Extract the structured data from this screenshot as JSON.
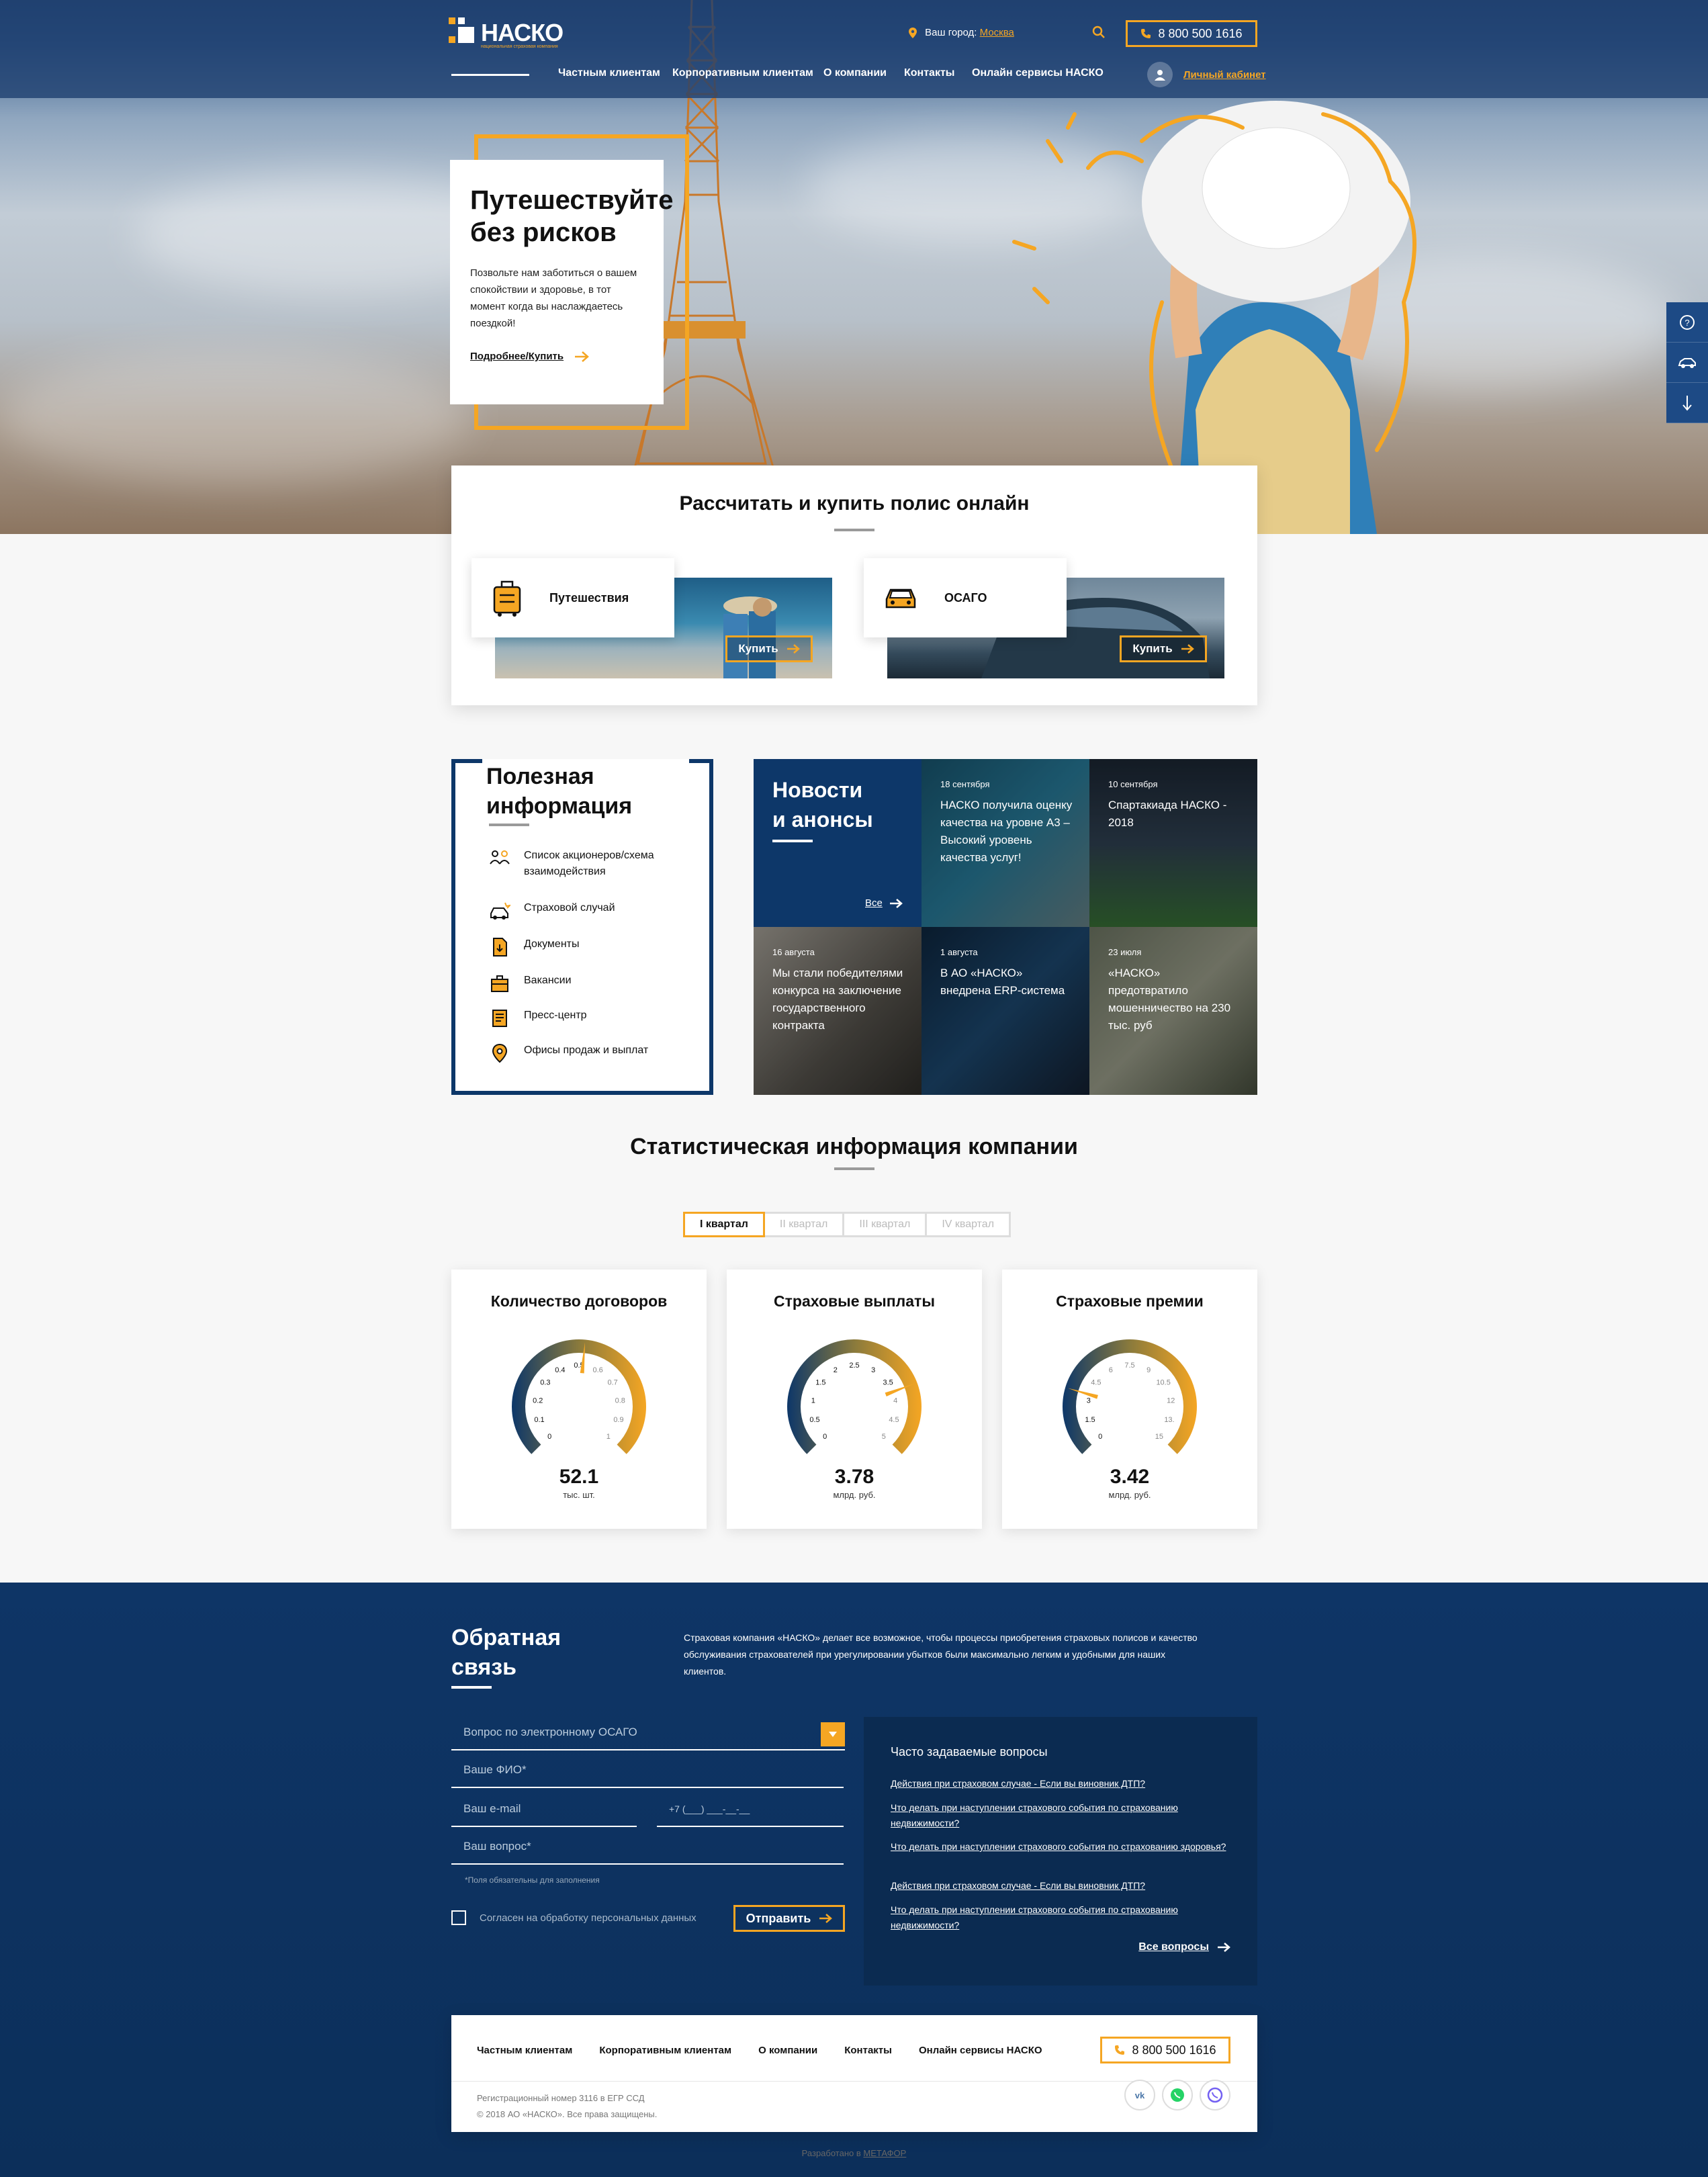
{
  "header": {
    "logo_text": "НАСКО",
    "logo_tagline": "национальная страховая компания",
    "city_label": "Ваш город:",
    "city_value": "Москва",
    "phone": "8 800 500 1616",
    "nav": [
      "Частным клиентам",
      "Корпоративным клиентам",
      "О компании",
      "Контакты",
      "Онлайн сервисы НАСКО"
    ],
    "cabinet": "Личный кабинет"
  },
  "hero": {
    "title_line1": "Путешествуйте",
    "title_line2": "без рисков",
    "text": "Позвольте нам заботиться о вашем спокойствии и здоровье, в тот момент когда вы наслаждаетесь поездкой!",
    "more": "Подробнее/Купить"
  },
  "calc": {
    "title": "Рассчитать и купить полис онлайн",
    "products": [
      {
        "label": "Путешествия",
        "button": "Купить"
      },
      {
        "label": "ОСАГО",
        "button": "Купить"
      }
    ]
  },
  "useful": {
    "title_line1": "Полезная",
    "title_line2": "информация",
    "items": [
      "Список акционеров/схема взаимодействия",
      "Страховой случай",
      "Документы",
      "Вакансии",
      "Пресс-центр",
      "Офисы продаж и выплат"
    ]
  },
  "news": {
    "title_line1": "Новости",
    "title_line2": "и анонсы",
    "all": "Все",
    "items": [
      {
        "date": "18 сентября",
        "title": "НАСКО получила оценку качества на уровне А3 – Высокий уровень качества услуг!"
      },
      {
        "date": "10 сентября",
        "title": "Спартакиада НАСКО - 2018"
      },
      {
        "date": "16 августа",
        "title": "Мы стали победителями конкурса на заключение государственного контракта"
      },
      {
        "date": "1 августа",
        "title": "В АО «НАСКО» внедрена ERP-система"
      },
      {
        "date": "23 июля",
        "title": "«НАСКО» предотвратило мошенничество на 230 тыс. руб"
      }
    ]
  },
  "stats": {
    "title": "Статистическая информация компании",
    "tabs": [
      "I квартал",
      "II квартал",
      "III квартал",
      "IV квартал"
    ],
    "cards": [
      {
        "title": "Количество договоров",
        "value": "52.1",
        "unit": "тыс. шт.",
        "ticks": [
          "0",
          "0.1",
          "0.2",
          "0.3",
          "0.4",
          "0.5",
          "0.6",
          "0.7",
          "0.8",
          "0.9",
          "1"
        ],
        "needle": 0.52
      },
      {
        "title": "Страховые выплаты",
        "value": "3.78",
        "unit": "млрд. руб.",
        "ticks": [
          "0",
          "0.5",
          "1",
          "1.5",
          "2",
          "2.5",
          "3",
          "3.5",
          "4",
          "4.5",
          "5"
        ],
        "needle": 0.756
      },
      {
        "title": "Страховые премии",
        "value": "3.42",
        "unit": "млрд. руб.",
        "ticks": [
          "0",
          "1.5",
          "3",
          "4.5",
          "6",
          "7.5",
          "9",
          "10.5",
          "12",
          "13.",
          "15"
        ],
        "needle": 0.228
      }
    ]
  },
  "feedback": {
    "title_line1": "Обратная",
    "title_line2": "связь",
    "description": "Страховая компания «НАСКО» делает все возможное, чтобы процессы приобретения страховых полисов и качество обслуживания страхователей при урегулировании убытков были максимально легким и удобными для наших клиентов.",
    "select": "Вопрос по электронному ОСАГО",
    "name_ph": "Ваше ФИО*",
    "email_ph": "Ваш e-mail",
    "phone_ph": "+7  (___) ___-__-__",
    "question_ph": "Ваш вопрос*",
    "required_note": "*Поля обязательны для заполнения",
    "consent": "Согласен на обработку персональных данных",
    "send": "Отправить"
  },
  "faq": {
    "title": "Часто задаваемые вопросы",
    "items": [
      "Действия при страховом случае - Если вы виновник ДТП?",
      "Что делать при наступлении страхового события по страхованию недвижимости?",
      "Что делать при наступлении страхового события по страхованию здоровья?",
      "Действия при страховом случае - Если вы виновник ДТП?",
      "Что делать при наступлении страхового события по страхованию недвижимости?"
    ],
    "all": "Все вопросы"
  },
  "footer": {
    "nav": [
      "Частным клиентам",
      "Корпоративным клиентам",
      "О компании",
      "Контакты",
      "Онлайн сервисы НАСКО"
    ],
    "phone": "8 800 500 1616",
    "reg": "Регистрационный номер 3116 в ЕГР ССД",
    "copyright": "© 2018 АО «НАСКО». Все права защищены.",
    "social": [
      "vk-icon",
      "whatsapp-icon",
      "viber-icon"
    ],
    "credit_prefix": "Разработано в",
    "credit_link": "МЕТАФОР"
  },
  "colors": {
    "accent": "#f5a623",
    "navy": "#0d3769"
  }
}
